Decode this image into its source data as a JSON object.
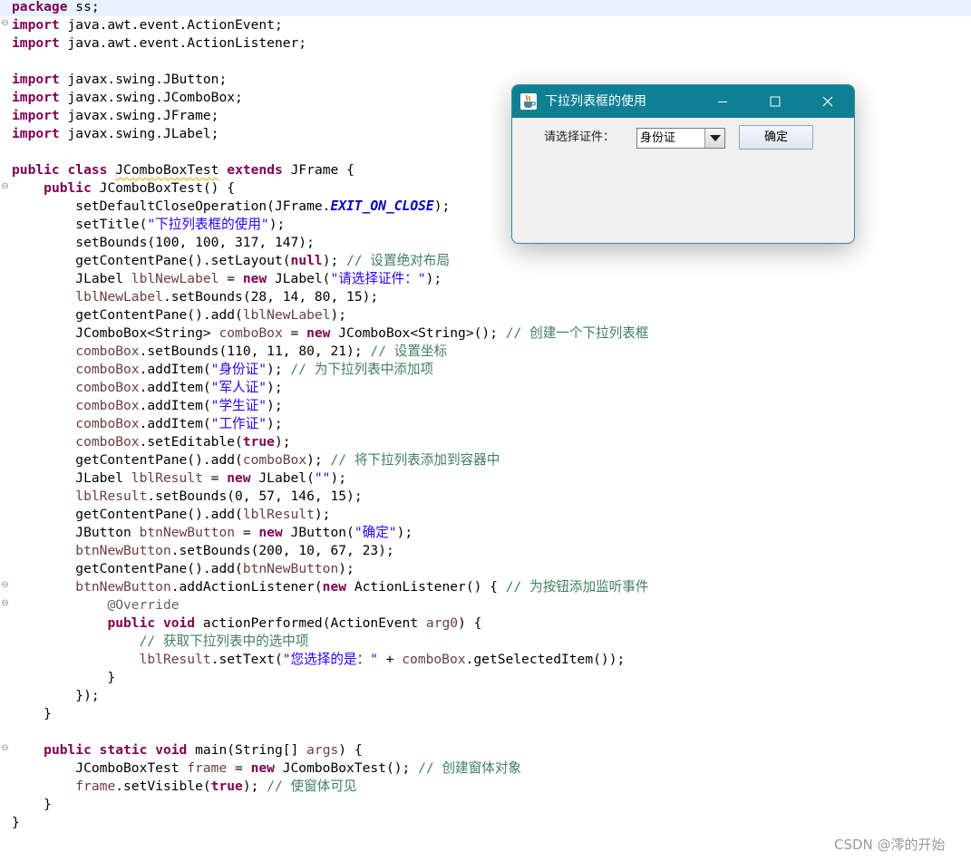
{
  "editor": {
    "lines": [
      [
        [
          "kw",
          "package"
        ],
        [
          "t",
          " ss;"
        ]
      ],
      [
        [
          "kw",
          "import"
        ],
        [
          "t",
          " java.awt.event.ActionEvent;"
        ]
      ],
      [
        [
          "kw",
          "import"
        ],
        [
          "t",
          " java.awt.event.ActionListener;"
        ]
      ],
      [],
      [
        [
          "kw",
          "import"
        ],
        [
          "t",
          " javax.swing.JButton;"
        ]
      ],
      [
        [
          "kw",
          "import"
        ],
        [
          "t",
          " javax.swing.JComboBox;"
        ]
      ],
      [
        [
          "kw",
          "import"
        ],
        [
          "t",
          " javax.swing.JFrame;"
        ]
      ],
      [
        [
          "kw",
          "import"
        ],
        [
          "t",
          " javax.swing.JLabel;"
        ]
      ],
      [],
      [
        [
          "kw",
          "public"
        ],
        [
          "t",
          " "
        ],
        [
          "kw",
          "class"
        ],
        [
          "t",
          " "
        ],
        [
          "warn",
          "JComboBoxTest"
        ],
        [
          "t",
          " "
        ],
        [
          "kw",
          "extends"
        ],
        [
          "t",
          " JFrame {"
        ]
      ],
      [
        [
          "t",
          "    "
        ],
        [
          "kw",
          "public"
        ],
        [
          "t",
          " JComboBoxTest() {"
        ]
      ],
      [
        [
          "t",
          "        setDefaultCloseOperation(JFrame."
        ],
        [
          "fld",
          "EXIT_ON_CLOSE"
        ],
        [
          "t",
          ");"
        ]
      ],
      [
        [
          "t",
          "        setTitle("
        ],
        [
          "str",
          "\"下拉列表框的使用\""
        ],
        [
          "t",
          ");"
        ]
      ],
      [
        [
          "t",
          "        setBounds(100, 100, 317, 147);"
        ]
      ],
      [
        [
          "t",
          "        getContentPane().setLayout("
        ],
        [
          "kw",
          "null"
        ],
        [
          "t",
          "); "
        ],
        [
          "cm",
          "// 设置绝对布局"
        ]
      ],
      [
        [
          "t",
          "        JLabel "
        ],
        [
          "var",
          "lblNewLabel"
        ],
        [
          "t",
          " = "
        ],
        [
          "kw",
          "new"
        ],
        [
          "t",
          " JLabel("
        ],
        [
          "str",
          "\"请选择证件：\""
        ],
        [
          "t",
          ");"
        ]
      ],
      [
        [
          "t",
          "        "
        ],
        [
          "var",
          "lblNewLabel"
        ],
        [
          "t",
          ".setBounds(28, 14, 80, 15);"
        ]
      ],
      [
        [
          "t",
          "        getContentPane().add("
        ],
        [
          "var",
          "lblNewLabel"
        ],
        [
          "t",
          ");"
        ]
      ],
      [
        [
          "t",
          "        JComboBox<String> "
        ],
        [
          "var",
          "comboBox"
        ],
        [
          "t",
          " = "
        ],
        [
          "kw",
          "new"
        ],
        [
          "t",
          " JComboBox<String>(); "
        ],
        [
          "cm",
          "// 创建一个下拉列表框"
        ]
      ],
      [
        [
          "t",
          "        "
        ],
        [
          "var",
          "comboBox"
        ],
        [
          "t",
          ".setBounds(110, 11, 80, 21); "
        ],
        [
          "cm",
          "// 设置坐标"
        ]
      ],
      [
        [
          "t",
          "        "
        ],
        [
          "var",
          "comboBox"
        ],
        [
          "t",
          ".addItem("
        ],
        [
          "str",
          "\"身份证\""
        ],
        [
          "t",
          "); "
        ],
        [
          "cm",
          "// 为下拉列表中添加项"
        ]
      ],
      [
        [
          "t",
          "        "
        ],
        [
          "var",
          "comboBox"
        ],
        [
          "t",
          ".addItem("
        ],
        [
          "str",
          "\"军人证\""
        ],
        [
          "t",
          ");"
        ]
      ],
      [
        [
          "t",
          "        "
        ],
        [
          "var",
          "comboBox"
        ],
        [
          "t",
          ".addItem("
        ],
        [
          "str",
          "\"学生证\""
        ],
        [
          "t",
          ");"
        ]
      ],
      [
        [
          "t",
          "        "
        ],
        [
          "var",
          "comboBox"
        ],
        [
          "t",
          ".addItem("
        ],
        [
          "str",
          "\"工作证\""
        ],
        [
          "t",
          ");"
        ]
      ],
      [
        [
          "t",
          "        "
        ],
        [
          "var",
          "comboBox"
        ],
        [
          "t",
          ".setEditable("
        ],
        [
          "kw",
          "true"
        ],
        [
          "t",
          ");"
        ]
      ],
      [
        [
          "t",
          "        getContentPane().add("
        ],
        [
          "var",
          "comboBox"
        ],
        [
          "t",
          "); "
        ],
        [
          "cm",
          "// 将下拉列表添加到容器中"
        ]
      ],
      [
        [
          "t",
          "        JLabel "
        ],
        [
          "var",
          "lblResult"
        ],
        [
          "t",
          " = "
        ],
        [
          "kw",
          "new"
        ],
        [
          "t",
          " JLabel("
        ],
        [
          "str",
          "\"\""
        ],
        [
          "t",
          ");"
        ]
      ],
      [
        [
          "t",
          "        "
        ],
        [
          "var",
          "lblResult"
        ],
        [
          "t",
          ".setBounds(0, 57, 146, 15);"
        ]
      ],
      [
        [
          "t",
          "        getContentPane().add("
        ],
        [
          "var",
          "lblResult"
        ],
        [
          "t",
          ");"
        ]
      ],
      [
        [
          "t",
          "        JButton "
        ],
        [
          "var",
          "btnNewButton"
        ],
        [
          "t",
          " = "
        ],
        [
          "kw",
          "new"
        ],
        [
          "t",
          " JButton("
        ],
        [
          "str",
          "\"确定\""
        ],
        [
          "t",
          ");"
        ]
      ],
      [
        [
          "t",
          "        "
        ],
        [
          "var",
          "btnNewButton"
        ],
        [
          "t",
          ".setBounds(200, 10, 67, 23);"
        ]
      ],
      [
        [
          "t",
          "        getContentPane().add("
        ],
        [
          "var",
          "btnNewButton"
        ],
        [
          "t",
          ");"
        ]
      ],
      [
        [
          "t",
          "        "
        ],
        [
          "var",
          "btnNewButton"
        ],
        [
          "t",
          ".addActionListener("
        ],
        [
          "kw",
          "new"
        ],
        [
          "t",
          " ActionListener() { "
        ],
        [
          "cm",
          "// 为按钮添加监听事件"
        ]
      ],
      [
        [
          "t",
          "            "
        ],
        [
          "ann",
          "@Override"
        ]
      ],
      [
        [
          "t",
          "            "
        ],
        [
          "kw",
          "public"
        ],
        [
          "t",
          " "
        ],
        [
          "kw",
          "void"
        ],
        [
          "t",
          " actionPerformed(ActionEvent "
        ],
        [
          "var",
          "arg0"
        ],
        [
          "t",
          ") {"
        ]
      ],
      [
        [
          "t",
          "                "
        ],
        [
          "cm",
          "// 获取下拉列表中的选中项"
        ]
      ],
      [
        [
          "t",
          "                "
        ],
        [
          "var",
          "lblResult"
        ],
        [
          "t",
          ".setText("
        ],
        [
          "str",
          "\"您选择的是：\""
        ],
        [
          "t",
          " + "
        ],
        [
          "var",
          "comboBox"
        ],
        [
          "t",
          ".getSelectedItem());"
        ]
      ],
      [
        [
          "t",
          "            }"
        ]
      ],
      [
        [
          "t",
          "        });"
        ]
      ],
      [
        [
          "t",
          "    }"
        ]
      ],
      [],
      [
        [
          "t",
          "    "
        ],
        [
          "kw",
          "public"
        ],
        [
          "t",
          " "
        ],
        [
          "kw",
          "static"
        ],
        [
          "t",
          " "
        ],
        [
          "kw",
          "void"
        ],
        [
          "t",
          " main(String[] "
        ],
        [
          "var",
          "args"
        ],
        [
          "t",
          ") {"
        ]
      ],
      [
        [
          "t",
          "        JComboBoxTest "
        ],
        [
          "var",
          "frame"
        ],
        [
          "t",
          " = "
        ],
        [
          "kw",
          "new"
        ],
        [
          "t",
          " JComboBoxTest(); "
        ],
        [
          "cm",
          "// 创建窗体对象"
        ]
      ],
      [
        [
          "t",
          "        "
        ],
        [
          "var",
          "frame"
        ],
        [
          "t",
          ".setVisible("
        ],
        [
          "kw",
          "true"
        ],
        [
          "t",
          "); "
        ],
        [
          "cm",
          "// 使窗体可见"
        ]
      ],
      [
        [
          "t",
          "    }"
        ]
      ],
      [
        [
          "t",
          "}"
        ]
      ]
    ],
    "current_line": 0,
    "fold_markers": [
      1,
      10,
      32,
      33,
      41
    ],
    "fold_icon": "collapse-minus-icon"
  },
  "dialog": {
    "title": "下拉列表框的使用",
    "app_icon": "java-cup-icon",
    "titlebar_color": "#0f7f93",
    "controls": [
      "minimize-icon",
      "maximize-icon",
      "close-icon"
    ],
    "label": "请选择证件：",
    "combo_value": "身份证",
    "button_label": "确定"
  },
  "watermark": "CSDN @澪的开始"
}
